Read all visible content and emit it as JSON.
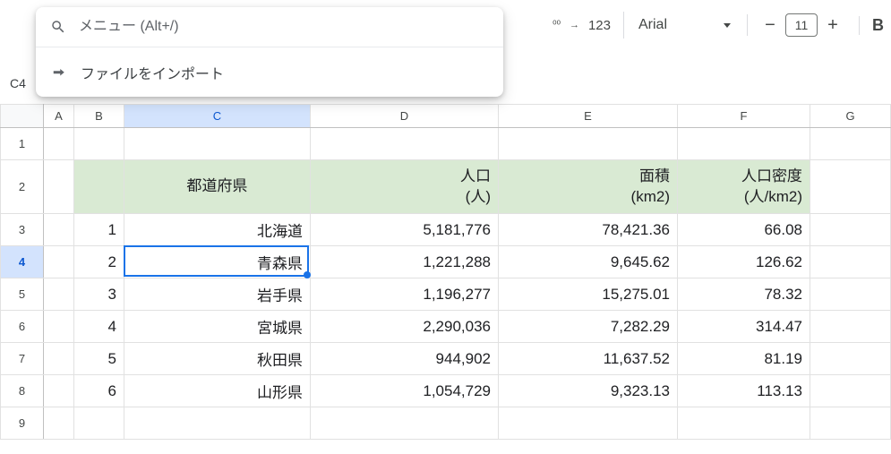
{
  "search": {
    "placeholder": "メニュー (Alt+/)",
    "suggestion": "ファイルをインポート"
  },
  "toolbar": {
    "number123": "123",
    "font_name": "Arial",
    "font_size": "11",
    "bold": "B"
  },
  "namebox": "C4",
  "columns": [
    "A",
    "B",
    "C",
    "D",
    "E",
    "F",
    "G"
  ],
  "row_headers": [
    "1",
    "2",
    "3",
    "4",
    "5",
    "6",
    "7",
    "8",
    "9"
  ],
  "selected_col": "C",
  "selected_row": "4",
  "header_row": {
    "B": "",
    "C": "都道府県",
    "D": "人口\n(人)",
    "E": "面積\n(km2)",
    "F": "人口密度\n(人/km2)"
  },
  "data_rows": [
    {
      "B": "1",
      "C": "北海道",
      "D": "5,181,776",
      "E": "78,421.36",
      "F": "66.08"
    },
    {
      "B": "2",
      "C": "青森県",
      "D": "1,221,288",
      "E": "9,645.62",
      "F": "126.62"
    },
    {
      "B": "3",
      "C": "岩手県",
      "D": "1,196,277",
      "E": "15,275.01",
      "F": "78.32"
    },
    {
      "B": "4",
      "C": "宮城県",
      "D": "2,290,036",
      "E": "7,282.29",
      "F": "314.47"
    },
    {
      "B": "5",
      "C": "秋田県",
      "D": "944,902",
      "E": "11,637.52",
      "F": "81.19"
    },
    {
      "B": "6",
      "C": "山形県",
      "D": "1,054,729",
      "E": "9,323.13",
      "F": "113.13"
    }
  ]
}
